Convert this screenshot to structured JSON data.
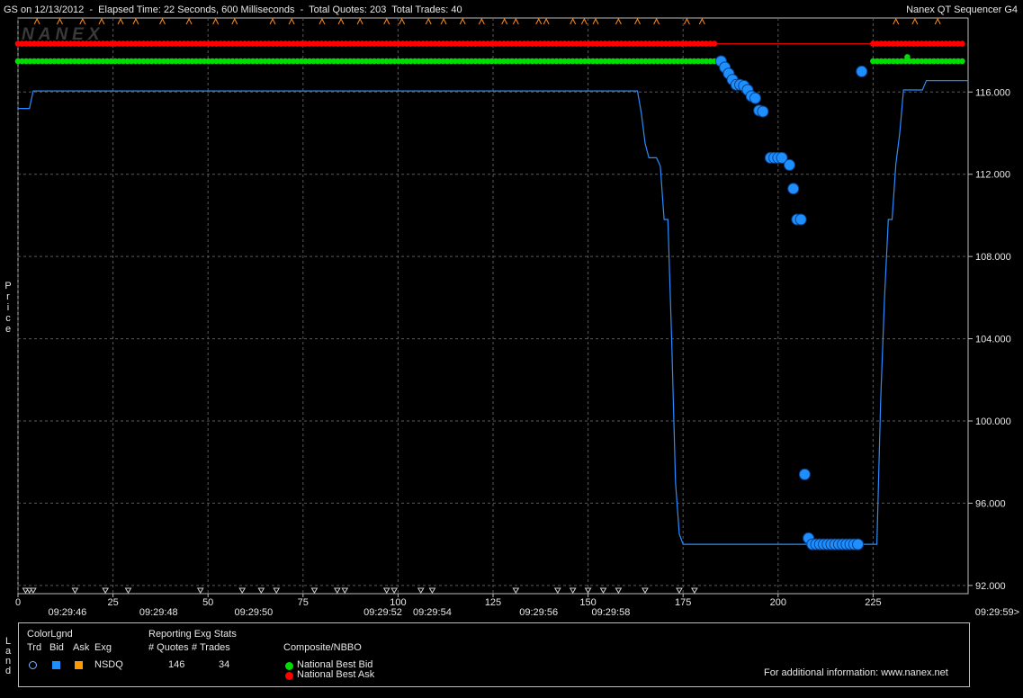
{
  "header": {
    "title": "GS on 12/13/2012  -  Elapsed Time: 22 Seconds, 600 Milliseconds  -  Total Quotes: 203  Total Trades: 40",
    "app_name": "Nanex QT Sequencer G4"
  },
  "watermark": "NANEX",
  "ylabel_chars": [
    "P",
    "r",
    "i",
    "c",
    "e"
  ],
  "legend_side_chars": [
    "L",
    "a",
    "n",
    "d"
  ],
  "colors": {
    "background": "#000000",
    "bid": "#00dd00",
    "ask": "#ff0000",
    "trade": "#1e8fff",
    "trade_line": "#2a8cff",
    "grid": "#5a5a5a",
    "axis": "#bdbdbd"
  },
  "chart_data": {
    "type": "line",
    "title": "",
    "xlabel": "",
    "ylabel": "Price",
    "xlim": [
      0,
      250
    ],
    "ylim": [
      91.6,
      119.6
    ],
    "grid": true,
    "x_ticks": [
      0,
      25,
      50,
      75,
      100,
      125,
      150,
      175,
      200,
      225
    ],
    "x_tick_labels": [
      "0",
      "25",
      "50",
      "75",
      "100",
      "125",
      "150",
      "175",
      "200",
      "225"
    ],
    "y_ticks": [
      92,
      96,
      100,
      104,
      108,
      112,
      116
    ],
    "y_tick_labels": [
      "92.000",
      "96.000",
      "100.000",
      "104.000",
      "108.000",
      "112.000",
      "116.000"
    ],
    "time_labels": [
      {
        "x": 13,
        "label": "09:29:46"
      },
      {
        "x": 37,
        "label": "09:29:48"
      },
      {
        "x": 62,
        "label": "09:29:50"
      },
      {
        "x": 96,
        "label": "09:29:52"
      },
      {
        "x": 109,
        "label": "09:29:54"
      },
      {
        "x": 137,
        "label": "09:29:56"
      },
      {
        "x": 156,
        "label": "09:29:58"
      },
      {
        "x": 250,
        "label": "09:29:59>"
      }
    ],
    "series": [
      {
        "name": "National Best Ask",
        "kind": "markers",
        "color": "#ff0000",
        "segments": [
          {
            "x_start": 0,
            "x_end": 184,
            "y": 118.35
          },
          {
            "x_start": 225,
            "x_end": 249,
            "y": 118.35
          }
        ],
        "connector": {
          "x_start": 184,
          "x_end": 225,
          "y": 118.35
        }
      },
      {
        "name": "National Best Bid",
        "kind": "markers",
        "color": "#00dd00",
        "segments": [
          {
            "x_start": 0,
            "x_end": 184,
            "y": 117.5
          },
          {
            "x_start": 225,
            "x_end": 249,
            "y": 117.5
          }
        ],
        "extra_points": [
          {
            "x": 234,
            "y": 117.7
          }
        ]
      },
      {
        "name": "NSDQ quote line",
        "kind": "line",
        "color": "#2a8cff",
        "points": [
          [
            0,
            115.2
          ],
          [
            3,
            115.2
          ],
          [
            4,
            116.05
          ],
          [
            163,
            116.05
          ],
          [
            164,
            115.0
          ],
          [
            165,
            113.5
          ],
          [
            166,
            112.8
          ],
          [
            168,
            112.8
          ],
          [
            169,
            112.4
          ],
          [
            170,
            109.8
          ],
          [
            171,
            109.8
          ],
          [
            172,
            104.0
          ],
          [
            173,
            97.0
          ],
          [
            174,
            94.5
          ],
          [
            175,
            94.0
          ],
          [
            226,
            94.0
          ],
          [
            227,
            101.0
          ],
          [
            228,
            106.0
          ],
          [
            229,
            109.8
          ],
          [
            230,
            109.8
          ],
          [
            231,
            112.5
          ],
          [
            232,
            114.0
          ],
          [
            233,
            116.1
          ],
          [
            238,
            116.1
          ],
          [
            239,
            116.55
          ],
          [
            250,
            116.55
          ]
        ]
      },
      {
        "name": "Trades",
        "kind": "scatter",
        "color": "#1e8fff",
        "points": [
          [
            185,
            117.5
          ],
          [
            186,
            117.2
          ],
          [
            187,
            116.9
          ],
          [
            188,
            116.6
          ],
          [
            189,
            116.35
          ],
          [
            190,
            116.35
          ],
          [
            191,
            116.3
          ],
          [
            192,
            116.1
          ],
          [
            193,
            115.8
          ],
          [
            194,
            115.7
          ],
          [
            195,
            115.1
          ],
          [
            196,
            115.05
          ],
          [
            198,
            112.8
          ],
          [
            199,
            112.8
          ],
          [
            200,
            112.8
          ],
          [
            201,
            112.8
          ],
          [
            203,
            112.45
          ],
          [
            204,
            111.3
          ],
          [
            205,
            109.8
          ],
          [
            206,
            109.8
          ],
          [
            207,
            97.4
          ],
          [
            208,
            94.3
          ],
          [
            209,
            94.0
          ],
          [
            210,
            94.0
          ],
          [
            211,
            94.0
          ],
          [
            212,
            94.0
          ],
          [
            213,
            94.0
          ],
          [
            214,
            94.0
          ],
          [
            215,
            94.0
          ],
          [
            216,
            94.0
          ],
          [
            217,
            94.0
          ],
          [
            218,
            94.0
          ],
          [
            219,
            94.0
          ],
          [
            220,
            94.0
          ],
          [
            221,
            94.0
          ],
          [
            222,
            117.0
          ]
        ]
      }
    ],
    "top_marker_x": [
      5,
      11,
      17,
      22,
      27,
      31,
      38,
      45,
      52,
      57,
      67,
      72,
      80,
      85,
      90,
      97,
      101,
      108,
      112,
      117,
      122,
      128,
      131,
      137,
      139,
      146,
      149,
      152,
      158,
      163,
      168,
      176,
      180,
      231,
      236,
      242
    ],
    "bottom_marker_x": [
      2,
      3,
      4,
      15,
      23,
      29,
      48,
      59,
      64,
      68,
      78,
      84,
      86,
      97,
      99,
      106,
      109,
      131,
      142,
      146,
      150,
      154,
      158,
      165,
      174,
      178
    ]
  },
  "legend": {
    "colorlgnd_title": "ColorLgnd",
    "col_trd": "Trd",
    "col_bid": "Bid",
    "col_ask": "Ask",
    "col_exg": "Exg",
    "exchange": "NSDQ",
    "stats_title": "Reporting Exg Stats",
    "col_quotes": "# Quotes",
    "col_trades": "# Trades",
    "quotes_value": "146",
    "trades_value": "34",
    "nbbo_title": "Composite/NBBO",
    "nbbo_bid_label": "National Best Bid",
    "nbbo_ask_label": "National Best Ask",
    "info": "For additional information: www.nanex.net"
  }
}
